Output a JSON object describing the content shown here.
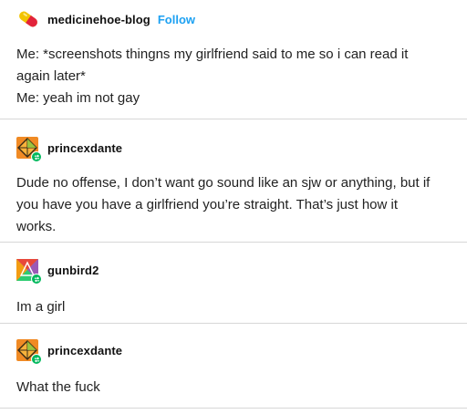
{
  "colors": {
    "follow": "#1da1f2",
    "divider": "#d7d7d7",
    "reblog_badge": "#00b85c",
    "text": "#222222"
  },
  "posts": [
    {
      "username": "medicinehoe-blog",
      "follow_label": "Follow",
      "avatar_icon": "pill-capsule-icon",
      "lines": [
        "Me: *screenshots thingns my girlfriend said to me so i can read it",
        "again later*",
        "Me: yeah im not gay"
      ]
    },
    {
      "username": "princexdante",
      "avatar_icon": "diamond-orange-avatar-icon",
      "badge_icon": "reblog-icon",
      "lines": [
        "Dude no offense, I don’t want go sound like an sjw or anything, but if",
        "you have you have a girlfriend you’re straight. That’s just how it",
        "works."
      ]
    },
    {
      "username": "gunbird2",
      "avatar_icon": "colorful-triangle-avatar-icon",
      "badge_icon": "reblog-icon",
      "lines": [
        "Im a girl"
      ]
    },
    {
      "username": "princexdante",
      "avatar_icon": "diamond-orange-avatar-icon",
      "badge_icon": "reblog-icon",
      "lines": [
        "What the fuck"
      ]
    }
  ]
}
